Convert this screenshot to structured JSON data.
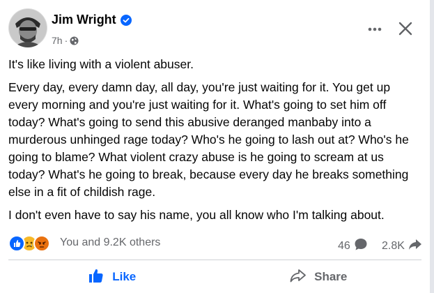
{
  "post": {
    "author": "Jim Wright",
    "time": "7h",
    "meta_separator": "·",
    "paragraphs": [
      "It's like living with a violent abuser.",
      "Every day, every damn day, all day, you're just waiting for it. You get up every morning and you're just waiting for it. What's going to set him off today? What's going to send this abusive deranged manbaby into a murderous unhinged rage today? Who's he going to lash out at? Who's he going to blame? What violent crazy abuse is he going to scream at us today? What's he going to break, because every day he breaks something else in a fit of childish rage.",
      "I don't even have to say his name, you all know who I'm talking about."
    ]
  },
  "reactions": {
    "icons": [
      "like-reaction-icon",
      "sad-reaction-icon",
      "angry-reaction-icon"
    ],
    "summary": "You and 9.2K others",
    "comments_count": "46",
    "shares_count": "2.8K"
  },
  "actions": {
    "like_label": "Like",
    "share_label": "Share"
  },
  "colors": {
    "brand_blue": "#0866ff",
    "secondary_text": "#65676b",
    "sad_yellow": "#f7b928",
    "angry_red": "#e9710f"
  }
}
